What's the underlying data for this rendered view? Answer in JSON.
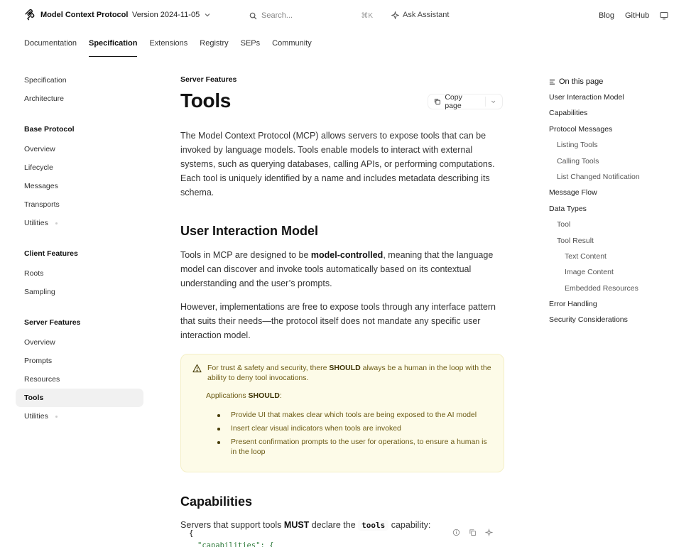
{
  "header": {
    "brand": "Model Context Protocol",
    "version": "Version 2024-11-05",
    "search_placeholder": "Search...",
    "search_shortcut": "⌘K",
    "ask_assistant": "Ask Assistant",
    "links": [
      "Blog",
      "GitHub"
    ]
  },
  "tabs": [
    {
      "label": "Documentation"
    },
    {
      "label": "Specification"
    },
    {
      "label": "Extensions"
    },
    {
      "label": "Registry"
    },
    {
      "label": "SEPs"
    },
    {
      "label": "Community"
    }
  ],
  "sidebar": {
    "top_items": [
      "Specification",
      "Architecture"
    ],
    "groups": [
      {
        "title": "Base Protocol",
        "items": [
          "Overview",
          "Lifecycle",
          "Messages",
          "Transports",
          "Utilities"
        ]
      },
      {
        "title": "Client Features",
        "items": [
          "Roots",
          "Sampling"
        ]
      },
      {
        "title": "Server Features",
        "items": [
          "Overview",
          "Prompts",
          "Resources",
          "Tools",
          "Utilities"
        ]
      }
    ]
  },
  "main": {
    "eyebrow": "Server Features",
    "title": "Tools",
    "copy_page": "Copy page",
    "intro": "The Model Context Protocol (MCP) allows servers to expose tools that can be invoked by language models. Tools enable models to interact with external systems, such as querying databases, calling APIs, or performing computations. Each tool is uniquely identified by a name and includes metadata describing its schema.",
    "section1_title": "User Interaction Model",
    "p2_before": "Tools in MCP are designed to be ",
    "p2_bold": "model-controlled",
    "p2_after": ", meaning that the language model can discover and invoke tools automatically based on its contextual understanding and the user’s prompts.",
    "p3": "However, implementations are free to expose tools through any interface pattern that suits their needs—the protocol itself does not mandate any specific user interaction model.",
    "warning": {
      "text_before": "For trust & safety and security, there ",
      "text_bold": "SHOULD",
      "text_after": " always be a human in the loop with the ability to deny tool invocations.",
      "sub_before": "Applications ",
      "sub_bold": "SHOULD",
      "sub_after": ":",
      "list": [
        "Provide UI that makes clear which tools are being exposed to the AI model",
        "Insert clear visual indicators when tools are invoked",
        "Present confirmation prompts to the user for operations, to ensure a human is in the loop"
      ]
    },
    "section2_title": "Capabilities",
    "p4_before": "Servers that support tools ",
    "p4_bold": "MUST",
    "p4_mid": " declare the ",
    "p4_code": "tools",
    "p4_after": " capability:",
    "code_line1": "{",
    "code_line2": "\"capabilities\": {"
  },
  "toc": {
    "title": "On this page",
    "items": [
      {
        "label": "User Interaction Model",
        "level": 1
      },
      {
        "label": "Capabilities",
        "level": 1
      },
      {
        "label": "Protocol Messages",
        "level": 1
      },
      {
        "label": "Listing Tools",
        "level": 2
      },
      {
        "label": "Calling Tools",
        "level": 2
      },
      {
        "label": "List Changed Notification",
        "level": 2
      },
      {
        "label": "Message Flow",
        "level": 1
      },
      {
        "label": "Data Types",
        "level": 1
      },
      {
        "label": "Tool",
        "level": 2
      },
      {
        "label": "Tool Result",
        "level": 2
      },
      {
        "label": "Text Content",
        "level": 3
      },
      {
        "label": "Image Content",
        "level": 3
      },
      {
        "label": "Embedded Resources",
        "level": 3
      },
      {
        "label": "Error Handling",
        "level": 1
      },
      {
        "label": "Security Considerations",
        "level": 1
      }
    ]
  }
}
